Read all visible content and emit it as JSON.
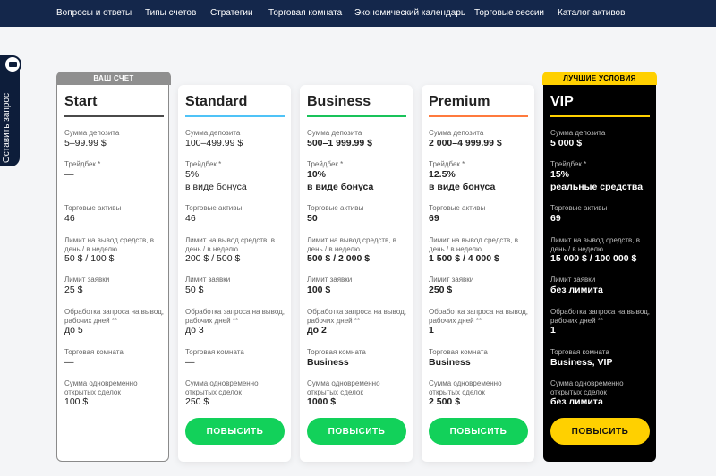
{
  "nav": [
    "Вопросы и ответы",
    "Типы счетов",
    "Стратегии",
    "Торговая комната",
    "Экономический календарь",
    "Торговые сессии",
    "Каталог активов"
  ],
  "side_tab": "Оставить запрос",
  "ribbons": {
    "start": "ВАШ СЧЕТ",
    "vip": "ЛУЧШИЕ УСЛОВИЯ"
  },
  "labels": {
    "deposit": "Сумма депозита",
    "tradeback": "Трейдбек *",
    "assets": "Торговые активы",
    "withdraw": "Лимит на вывод средств, в день / в неделю",
    "order": "Лимит заявки",
    "processing": "Обработка запроса на вывод, рабочих дней **",
    "room": "Торговая комната",
    "open": "Сумма одновременно открытых сделок"
  },
  "cards": [
    {
      "name": "Start",
      "deposit": "5–99.99 $",
      "tradeback": "—",
      "tradeback2": "",
      "assets": "46",
      "withdraw": "50 $ / 100 $",
      "order": "25 $",
      "processing": "до 5",
      "room": "—",
      "open": "100 $",
      "button": ""
    },
    {
      "name": "Standard",
      "deposit": "100–499.99 $",
      "tradeback": "5%",
      "tradeback2": "в виде бонуса",
      "assets": "46",
      "withdraw": "200 $ / 500 $",
      "order": "50 $",
      "processing": "до 3",
      "room": "—",
      "open": "250 $",
      "button": "ПОВЫСИТЬ"
    },
    {
      "name": "Business",
      "deposit": "500–1 999.99 $",
      "tradeback": "10%",
      "tradeback2": "в виде бонуса",
      "assets": "50",
      "withdraw": "500 $ / 2 000 $",
      "order": "100 $",
      "processing": "до 2",
      "room": "Business",
      "open": "1000 $",
      "button": "ПОВЫСИТЬ"
    },
    {
      "name": "Premium",
      "deposit": "2 000–4 999.99 $",
      "tradeback": "12.5%",
      "tradeback2": "в виде бонуса",
      "assets": "69",
      "withdraw": "1 500 $ / 4 000 $",
      "order": "250 $",
      "processing": "1",
      "room": "Business",
      "open": "2 500 $",
      "button": "ПОВЫСИТЬ"
    },
    {
      "name": "VIP",
      "deposit": "5 000 $",
      "tradeback": "15%",
      "tradeback2": "реальные средства",
      "assets": "69",
      "withdraw": "15 000 $ / 100 000 $",
      "order": "без лимита",
      "processing": "1",
      "room": "Business, VIP",
      "open": "без лимита",
      "button": "ПОВЫСИТЬ"
    }
  ],
  "colors": {
    "nav": "#14274b",
    "start": "#4a4a4a",
    "standard": "#4fc3f7",
    "business": "#19c35a",
    "premium": "#ff7a3d",
    "vip": "#ffd000",
    "button_green": "#12d15a",
    "button_yellow": "#ffd000"
  }
}
